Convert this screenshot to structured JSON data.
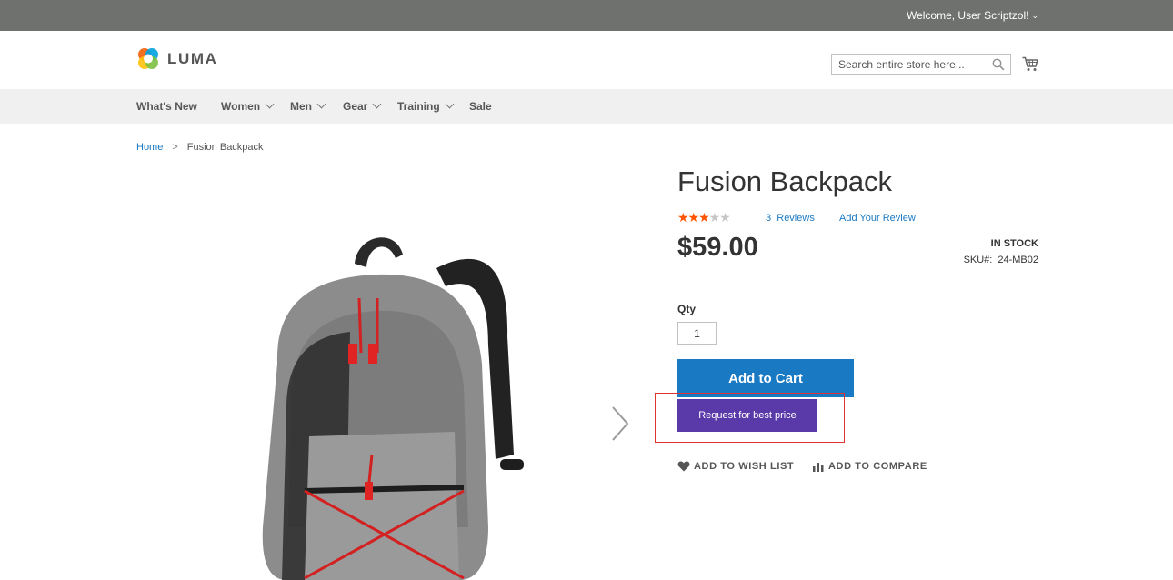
{
  "topbar": {
    "welcome": "Welcome, User Scriptzol!"
  },
  "header": {
    "logo_text": "LUMA",
    "search": {
      "placeholder": "Search entire store here..."
    }
  },
  "nav": {
    "items": [
      {
        "label": "What's New",
        "has_dropdown": false
      },
      {
        "label": "Women",
        "has_dropdown": true
      },
      {
        "label": "Men",
        "has_dropdown": true
      },
      {
        "label": "Gear",
        "has_dropdown": true
      },
      {
        "label": "Training",
        "has_dropdown": true
      },
      {
        "label": "Sale",
        "has_dropdown": false
      }
    ]
  },
  "breadcrumb": {
    "home": "Home",
    "separator": ">",
    "current": "Fusion Backpack"
  },
  "product": {
    "title": "Fusion Backpack",
    "rating": {
      "value": 3.5,
      "max": 5,
      "reviews_count": "3",
      "reviews_label": "Reviews",
      "add_review": "Add Your Review"
    },
    "price": "$59.00",
    "stock": "IN STOCK",
    "sku_label": "SKU#:",
    "sku": "24-MB02",
    "qty_label": "Qty",
    "qty_value": "1",
    "add_to_cart": "Add to Cart",
    "request_best_price": "Request for best price",
    "wish_list": "ADD TO WISH LIST",
    "compare": "ADD TO COMPARE"
  },
  "colors": {
    "topbar": "#6e716e",
    "primary_button": "#1979c3",
    "request_button": "#5a3aa8",
    "highlight": "#e0322f",
    "star_on": "#ff5501",
    "star_off": "#c7c7c7"
  }
}
